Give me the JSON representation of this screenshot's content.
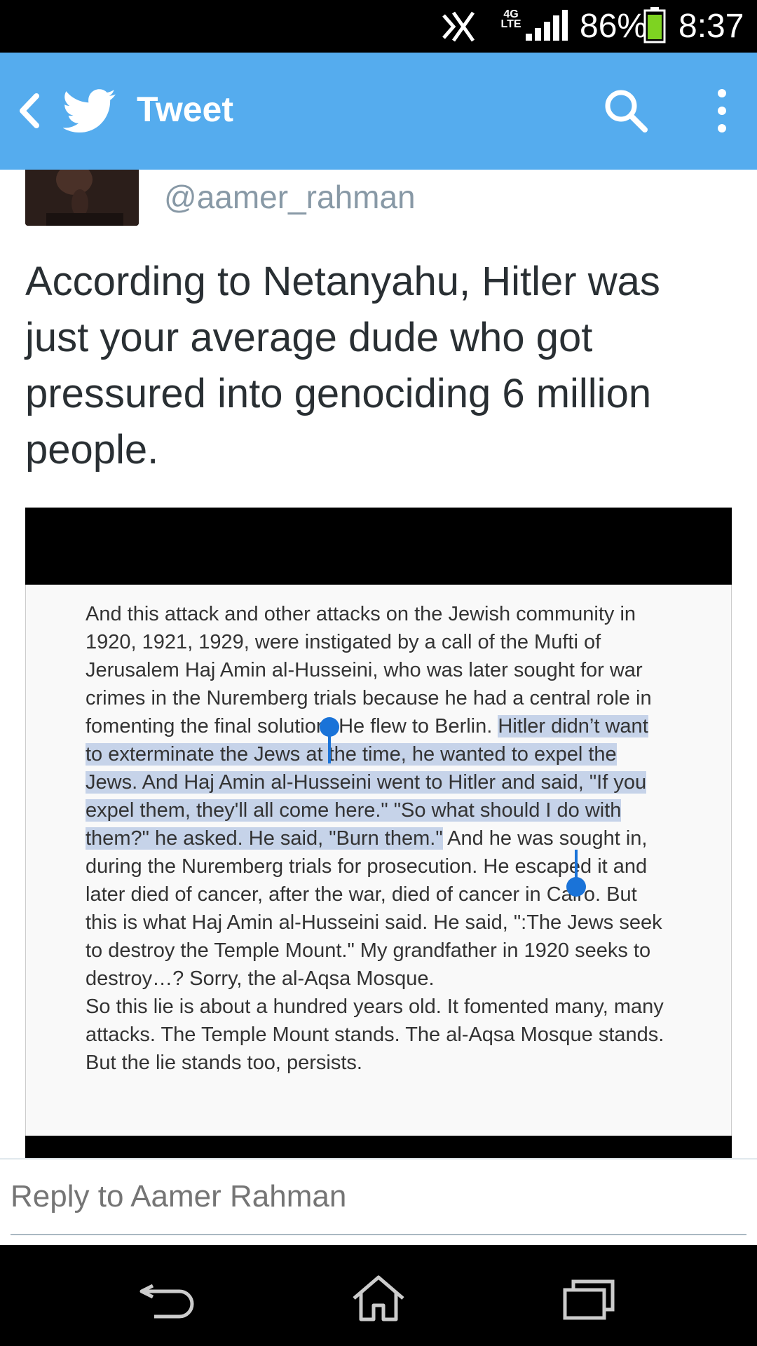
{
  "status_bar": {
    "network": "4G",
    "network_sub": "LTE",
    "battery": "86%",
    "time": "8:37"
  },
  "app_bar": {
    "title": "Tweet",
    "icons": [
      "back-arrow-icon",
      "twitter-bird-icon",
      "search-icon",
      "overflow-menu-icon"
    ]
  },
  "tweet": {
    "handle": "@aamer_rahman",
    "text": "According to Netanyahu, Hitler was just your average dude who got pressured into genociding 6 million people."
  },
  "media": {
    "text_before_selection": "And this attack and other attacks on the Jewish community in 1920, 1921, 1929, were instigated by a call of the Mufti of Jerusalem Haj Amin al-Husseini, who was later sought for war crimes in the Nuremberg trials because he had a central role in fomenting the final solution. He flew to Berlin. ",
    "selected_text": "Hitler didn’t want to exterminate the Jews at the time, he wanted to expel the Jews. And Haj Amin al-Husseini went to Hitler and said, \"If you expel them, they'll all come here.\" \"So what should I do with them?\" he asked. He said, \"Burn them.\"",
    "text_after_selection": " And he was sought in, during the Nuremberg trials for prosecution. He escaped it and later died of cancer, after the war, died of cancer in Cairo. But this is what Haj Amin al-Husseini said. He said, \":The Jews seek to destroy the Temple Mount.\" My grandfather in 1920 seeks to destroy…? Sorry, the al-Aqsa Mosque.",
    "paragraph2": "So this lie is about a hundred years old. It fomented many, many attacks. The Temple Mount stands. The al-Aqsa Mosque stands. But the lie stands too, persists."
  },
  "reply": {
    "placeholder": "Reply to Aamer Rahman"
  },
  "nav_bar": {
    "icons": [
      "back-icon",
      "home-icon",
      "recent-apps-icon"
    ]
  },
  "colors": {
    "twitter_blue": "#55acee",
    "selection": "#c6d3e9",
    "selection_handle": "#1a73d8",
    "battery_green": "#7ed321"
  }
}
